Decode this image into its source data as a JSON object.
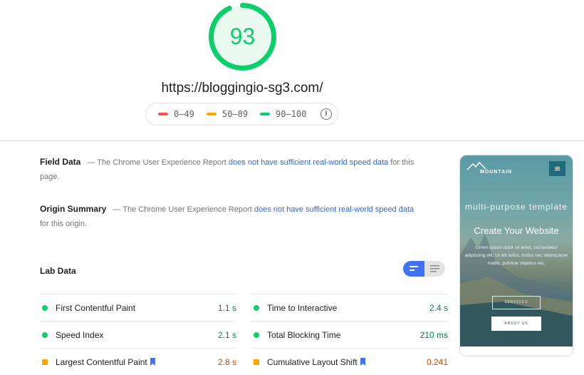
{
  "score": {
    "value": "93",
    "fraction": 0.93,
    "color": "#0cce6b",
    "fill": "#e8f8ef"
  },
  "url": "https://bloggingio-sg3.com/",
  "legend": {
    "items": [
      {
        "label": "0–49",
        "color": "#ff4e42"
      },
      {
        "label": "50–89",
        "color": "#ffa400"
      },
      {
        "label": "90–100",
        "color": "#0cce6b"
      }
    ],
    "info_icon": "i"
  },
  "field_data": {
    "title": "Field Data",
    "prefix": "— The Chrome User Experience Report",
    "link": "does not have sufficient real-world speed data",
    "suffix": "for this page."
  },
  "origin_summary": {
    "title": "Origin Summary",
    "prefix": "— The Chrome User Experience Report",
    "link": "does not have sufficient real-world speed data",
    "suffix": "for this origin."
  },
  "lab_data": {
    "title": "Lab Data",
    "toggle": {
      "active": "list-view",
      "inactive": "detail-view"
    },
    "metrics": [
      {
        "label": "First Contentful Paint",
        "value": "1.1 s",
        "status": "pass",
        "bookmark": false
      },
      {
        "label": "Time to Interactive",
        "value": "2.4 s",
        "status": "pass",
        "bookmark": false
      },
      {
        "label": "Speed Index",
        "value": "2.1 s",
        "status": "pass",
        "bookmark": false
      },
      {
        "label": "Total Blocking Time",
        "value": "210 ms",
        "status": "pass",
        "bookmark": false
      },
      {
        "label": "Largest Contentful Paint",
        "value": "2.8 s",
        "status": "avg",
        "bookmark": true
      },
      {
        "label": "Cumulative Layout Shift",
        "value": "0.241",
        "status": "avg",
        "bookmark": true
      }
    ]
  },
  "preview": {
    "logo": "MOUNTAIN",
    "tagline": "multi-purpose template",
    "headline": "Create Your Website",
    "body": "Lorem ipsum dolor sit amet, consectetur adipiscing elit. Ut elit tellus, luctus nec ullamcorper mattis, pulvinar dapibus leo.",
    "button1": "SERVICES",
    "button2": "ABOUT US"
  }
}
